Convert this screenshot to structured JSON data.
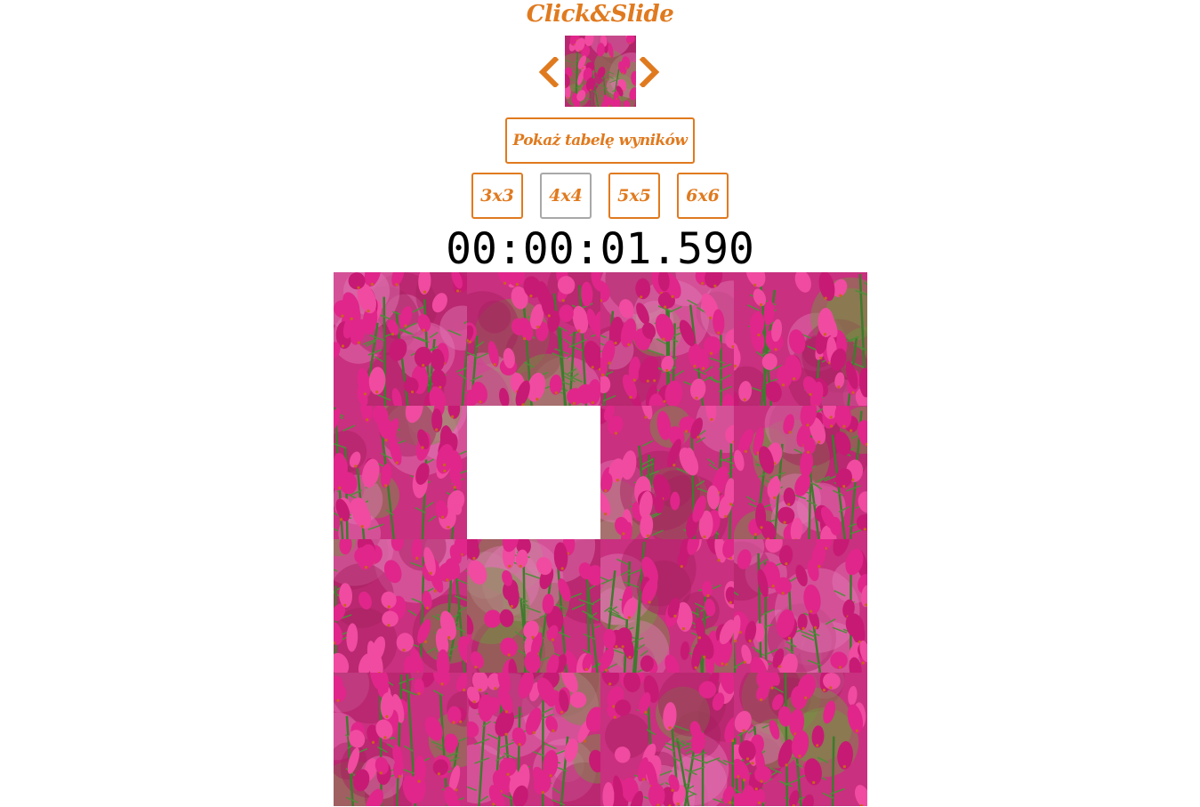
{
  "app": {
    "title": "Click&Slide"
  },
  "preview": {
    "prev_icon": "chevron-left-icon",
    "next_icon": "chevron-right-icon",
    "image_name": "pink-heather-flowers"
  },
  "buttons": {
    "scores_label": "Pokaż tabelę wyników",
    "sizes": [
      "3x3",
      "4x4",
      "5x5",
      "6x6"
    ],
    "selected_size": "4x4"
  },
  "timer": {
    "value": "00:00:01.590"
  },
  "board": {
    "rows": 4,
    "cols": 4,
    "empty_cell": {
      "row": 2,
      "col": 2
    }
  },
  "colors": {
    "accent": "#e07a1f",
    "selected_border": "#a8a8a8",
    "flower": "#d6237f",
    "foliage": "#5f8f3a"
  }
}
